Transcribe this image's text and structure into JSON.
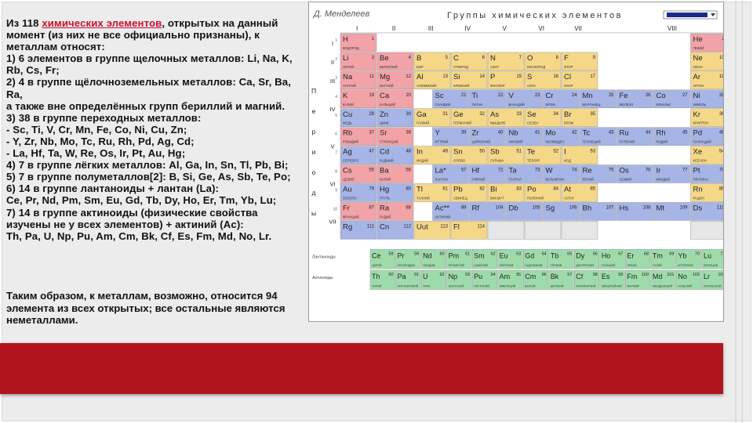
{
  "text": {
    "lines": [
      {
        "pre": "Из 118 ",
        "link": "химических элементов",
        "post": ", открытых на данный"
      },
      {
        "pre": "момент (из них не все официально признаны), к",
        "link": "",
        "post": ""
      },
      {
        "pre": "металлам относят:",
        "link": "",
        "post": ""
      },
      {
        "pre": "1) 6 элементов в группе щелочных металлов: Li, Na, K,",
        "link": "",
        "post": ""
      },
      {
        "pre": "Rb, Cs, Fr;",
        "link": "",
        "post": ""
      },
      {
        "pre": "2) 4 в группе щёлочноземельных металлов: Ca, Sr, Ba,",
        "link": "",
        "post": ""
      },
      {
        "pre": "Ra,",
        "link": "",
        "post": ""
      },
      {
        "pre": "а также вне определённых групп бериллий и магний.",
        "link": "",
        "post": ""
      },
      {
        "pre": "3) 38 в группе переходных металлов:",
        "link": "",
        "post": ""
      },
      {
        "pre": "- Sc, Ti, V, Cr, Mn, Fe, Co, Ni, Cu, Zn;",
        "link": "",
        "post": ""
      },
      {
        "pre": "- Y, Zr, Nb, Mo, Tc, Ru, Rh, Pd, Ag, Cd;",
        "link": "",
        "post": ""
      },
      {
        "pre": "- La, Hf, Ta, W, Re, Os, Ir, Pt, Au, Hg;",
        "link": "",
        "post": ""
      },
      {
        "pre": "4) 7 в группе лёгких металлов: Al, Ga, In, Sn, Tl, Pb, Bi;",
        "link": "",
        "post": ""
      },
      {
        "pre": "5) 7 в группе полуметаллов[2]: B, Si, Ge, As, Sb, Te, Po;",
        "link": "",
        "post": ""
      },
      {
        "pre": "6) 14 в группе лантаноиды + лантан (La):",
        "link": "",
        "post": ""
      },
      {
        "pre": "Ce, Pr, Nd, Pm, Sm, Eu, Gd, Tb, Dy, Ho, Er, Tm, Yb, Lu;",
        "link": "",
        "post": ""
      },
      {
        "pre": "7) 14 в группе актиноиды (физические свойства",
        "link": "",
        "post": ""
      },
      {
        "pre": "изучены не у всех элементов) + актиний (Ac):",
        "link": "",
        "post": ""
      },
      {
        "pre": "Th, Pa, U, Np, Pu, Am, Cm, Bk, Cf, Es, Fm, Md, No, Lr.",
        "link": "",
        "post": ""
      }
    ],
    "ending": [
      "Таким образом, к металлам, возможно, относится 94",
      "элемента из всех открытых; все остальные являются",
      "неметаллами."
    ]
  },
  "table": {
    "signature": "Д. Менделеев",
    "title": "Группы химических элементов",
    "groups": [
      "I",
      "II",
      "III",
      "IV",
      "V",
      "VI",
      "VII",
      "VIII"
    ],
    "period_word": [
      "П",
      "е",
      "р",
      "и",
      "о",
      "д",
      "ы"
    ],
    "periods": [
      "I",
      "II",
      "III",
      "IV",
      "V",
      "VI",
      "VII"
    ],
    "row_labels": [
      "1",
      "2",
      "3",
      "4",
      "5",
      "6",
      "7",
      "8",
      "9",
      "10"
    ],
    "lanthanide_label": "Лантаноиды",
    "actinide_label": "Актиноиды",
    "colors": {
      "s": "#f2a3a8",
      "p": "#f5d788",
      "d": "#a6b4e6",
      "f": "#9edbaa",
      "empty": "#e6e6e6"
    },
    "cells": [
      {
        "sym": "H",
        "n": "1",
        "name": "ВОДОРОД",
        "c": "s",
        "r": 0,
        "col": 0
      },
      {
        "sym": "He",
        "n": "2",
        "name": "ГЕЛИЙ",
        "c": "s",
        "r": 0,
        "col": 19
      },
      {
        "sym": "Li",
        "n": "3",
        "name": "ЛИТИЙ",
        "c": "s",
        "r": 1,
        "col": 0
      },
      {
        "sym": "Be",
        "n": "4",
        "name": "БЕРИЛЛИЙ",
        "c": "s",
        "r": 1,
        "col": 2
      },
      {
        "sym": "B",
        "n": "5",
        "name": "БОР",
        "c": "p",
        "r": 1,
        "col": 4
      },
      {
        "sym": "C",
        "n": "6",
        "name": "УГЛЕРОД",
        "c": "p",
        "r": 1,
        "col": 6
      },
      {
        "sym": "N",
        "n": "7",
        "name": "АЗОТ",
        "c": "p",
        "r": 1,
        "col": 8
      },
      {
        "sym": "O",
        "n": "8",
        "name": "КИСЛОРОД",
        "c": "p",
        "r": 1,
        "col": 10
      },
      {
        "sym": "F",
        "n": "9",
        "name": "ФТОР",
        "c": "p",
        "r": 1,
        "col": 12
      },
      {
        "sym": "Ne",
        "n": "10",
        "name": "НЕОН",
        "c": "p",
        "r": 1,
        "col": 19
      },
      {
        "sym": "Na",
        "n": "11",
        "name": "НАТРИЙ",
        "c": "s",
        "r": 2,
        "col": 0
      },
      {
        "sym": "Mg",
        "n": "12",
        "name": "МАГНИЙ",
        "c": "s",
        "r": 2,
        "col": 2
      },
      {
        "sym": "Al",
        "n": "13",
        "name": "АЛЮМИНИЙ",
        "c": "p",
        "r": 2,
        "col": 4
      },
      {
        "sym": "Si",
        "n": "14",
        "name": "КРЕМНИЙ",
        "c": "p",
        "r": 2,
        "col": 6
      },
      {
        "sym": "P",
        "n": "15",
        "name": "ФОСФОР",
        "c": "p",
        "r": 2,
        "col": 8
      },
      {
        "sym": "S",
        "n": "16",
        "name": "СЕРА",
        "c": "p",
        "r": 2,
        "col": 10
      },
      {
        "sym": "Cl",
        "n": "17",
        "name": "ХЛОР",
        "c": "p",
        "r": 2,
        "col": 12
      },
      {
        "sym": "Ar",
        "n": "18",
        "name": "АРГОН",
        "c": "p",
        "r": 2,
        "col": 19
      },
      {
        "sym": "K",
        "n": "19",
        "name": "КАЛИЙ",
        "c": "s",
        "r": 3,
        "col": 0
      },
      {
        "sym": "Ca",
        "n": "20",
        "name": "КАЛЬЦИЙ",
        "c": "s",
        "r": 3,
        "col": 2
      },
      {
        "sym": "Sc",
        "n": "21",
        "name": "СКАНДИЙ",
        "c": "d",
        "r": 3,
        "col": 5
      },
      {
        "sym": "Ti",
        "n": "22",
        "name": "ТИТАН",
        "c": "d",
        "r": 3,
        "col": 7
      },
      {
        "sym": "V",
        "n": "23",
        "name": "ВАНАДИЙ",
        "c": "d",
        "r": 3,
        "col": 9
      },
      {
        "sym": "Cr",
        "n": "24",
        "name": "ХРОМ",
        "c": "d",
        "r": 3,
        "col": 11
      },
      {
        "sym": "Mn",
        "n": "25",
        "name": "МАРГАНЕЦ",
        "c": "d",
        "r": 3,
        "col": 13
      },
      {
        "sym": "Fe",
        "n": "26",
        "name": "ЖЕЛЕЗО",
        "c": "d",
        "r": 3,
        "col": 15
      },
      {
        "sym": "Co",
        "n": "27",
        "name": "КОБАЛЬТ",
        "c": "d",
        "r": 3,
        "col": 17
      },
      {
        "sym": "Ni",
        "n": "28",
        "name": "НИКЕЛЬ",
        "c": "d",
        "r": 3,
        "col": 19
      },
      {
        "sym": "Cu",
        "n": "29",
        "name": "МЕДЬ",
        "c": "d",
        "r": 4,
        "col": 0
      },
      {
        "sym": "Zn",
        "n": "30",
        "name": "ЦИНК",
        "c": "d",
        "r": 4,
        "col": 2
      },
      {
        "sym": "Ga",
        "n": "31",
        "name": "ГАЛЛИЙ",
        "c": "p",
        "r": 4,
        "col": 4
      },
      {
        "sym": "Ge",
        "n": "32",
        "name": "ГЕРМАНИЙ",
        "c": "p",
        "r": 4,
        "col": 6
      },
      {
        "sym": "As",
        "n": "33",
        "name": "МЫШЬЯК",
        "c": "p",
        "r": 4,
        "col": 8
      },
      {
        "sym": "Se",
        "n": "34",
        "name": "СЕЛЕН",
        "c": "p",
        "r": 4,
        "col": 10
      },
      {
        "sym": "Br",
        "n": "35",
        "name": "БРОМ",
        "c": "p",
        "r": 4,
        "col": 12
      },
      {
        "sym": "Kr",
        "n": "36",
        "name": "КРИПТОН",
        "c": "p",
        "r": 4,
        "col": 19
      },
      {
        "sym": "Rb",
        "n": "37",
        "name": "РУБИДИЙ",
        "c": "s",
        "r": 5,
        "col": 0
      },
      {
        "sym": "Sr",
        "n": "38",
        "name": "СТРОНЦИЙ",
        "c": "s",
        "r": 5,
        "col": 2
      },
      {
        "sym": "Y",
        "n": "39",
        "name": "ИТТРИЙ",
        "c": "d",
        "r": 5,
        "col": 5
      },
      {
        "sym": "Zr",
        "n": "40",
        "name": "ЦИРКОНИЙ",
        "c": "d",
        "r": 5,
        "col": 7
      },
      {
        "sym": "Nb",
        "n": "41",
        "name": "НИОБИЙ",
        "c": "d",
        "r": 5,
        "col": 9
      },
      {
        "sym": "Mo",
        "n": "42",
        "name": "МОЛИБДЕН",
        "c": "d",
        "r": 5,
        "col": 11
      },
      {
        "sym": "Tc",
        "n": "43",
        "name": "ТЕХНЕЦИЙ",
        "c": "d",
        "r": 5,
        "col": 13
      },
      {
        "sym": "Ru",
        "n": "44",
        "name": "РУТЕНИЙ",
        "c": "d",
        "r": 5,
        "col": 15
      },
      {
        "sym": "Rh",
        "n": "45",
        "name": "РОДИЙ",
        "c": "d",
        "r": 5,
        "col": 17
      },
      {
        "sym": "Pd",
        "n": "46",
        "name": "ПАЛЛАДИЙ",
        "c": "d",
        "r": 5,
        "col": 19
      },
      {
        "sym": "Ag",
        "n": "47",
        "name": "СЕРЕБРО",
        "c": "d",
        "r": 6,
        "col": 0
      },
      {
        "sym": "Cd",
        "n": "48",
        "name": "КАДМИЙ",
        "c": "d",
        "r": 6,
        "col": 2
      },
      {
        "sym": "In",
        "n": "49",
        "name": "ИНДИЙ",
        "c": "p",
        "r": 6,
        "col": 4
      },
      {
        "sym": "Sn",
        "n": "50",
        "name": "ОЛОВО",
        "c": "p",
        "r": 6,
        "col": 6
      },
      {
        "sym": "Sb",
        "n": "51",
        "name": "СУРЬМА",
        "c": "p",
        "r": 6,
        "col": 8
      },
      {
        "sym": "Te",
        "n": "52",
        "name": "ТЕЛЛУР",
        "c": "p",
        "r": 6,
        "col": 10
      },
      {
        "sym": "I",
        "n": "53",
        "name": "ИОД",
        "c": "p",
        "r": 6,
        "col": 12
      },
      {
        "sym": "Xe",
        "n": "54",
        "name": "КСЕНОН",
        "c": "p",
        "r": 6,
        "col": 19
      },
      {
        "sym": "Cs",
        "n": "55",
        "name": "ЦЕЗИЙ",
        "c": "s",
        "r": 7,
        "col": 0
      },
      {
        "sym": "Ba",
        "n": "56",
        "name": "БАРИЙ",
        "c": "s",
        "r": 7,
        "col": 2
      },
      {
        "sym": "La*",
        "n": "57",
        "name": "ЛАНТАН",
        "c": "d",
        "r": 7,
        "col": 5
      },
      {
        "sym": "Hf",
        "n": "72",
        "name": "ГАФНИЙ",
        "c": "d",
        "r": 7,
        "col": 7
      },
      {
        "sym": "Ta",
        "n": "73",
        "name": "ТАНТАЛ",
        "c": "d",
        "r": 7,
        "col": 9
      },
      {
        "sym": "W",
        "n": "74",
        "name": "ВОЛЬФРАМ",
        "c": "d",
        "r": 7,
        "col": 11
      },
      {
        "sym": "Re",
        "n": "75",
        "name": "РЕНИЙ",
        "c": "d",
        "r": 7,
        "col": 13
      },
      {
        "sym": "Os",
        "n": "76",
        "name": "ОСМИЙ",
        "c": "d",
        "r": 7,
        "col": 15
      },
      {
        "sym": "Ir",
        "n": "77",
        "name": "ИРИДИЙ",
        "c": "d",
        "r": 7,
        "col": 17
      },
      {
        "sym": "Pt",
        "n": "78",
        "name": "ПЛАТИНА",
        "c": "d",
        "r": 7,
        "col": 19
      },
      {
        "sym": "Au",
        "n": "79",
        "name": "ЗОЛОТО",
        "c": "d",
        "r": 8,
        "col": 0
      },
      {
        "sym": "Hg",
        "n": "80",
        "name": "РТУТЬ",
        "c": "d",
        "r": 8,
        "col": 2
      },
      {
        "sym": "Tl",
        "n": "81",
        "name": "ТАЛЛИЙ",
        "c": "p",
        "r": 8,
        "col": 4
      },
      {
        "sym": "Pb",
        "n": "82",
        "name": "СВИНЕЦ",
        "c": "p",
        "r": 8,
        "col": 6
      },
      {
        "sym": "Bi",
        "n": "83",
        "name": "ВИСМУТ",
        "c": "p",
        "r": 8,
        "col": 8
      },
      {
        "sym": "Po",
        "n": "84",
        "name": "ПОЛОНИЙ",
        "c": "p",
        "r": 8,
        "col": 10
      },
      {
        "sym": "At",
        "n": "85",
        "name": "АСТАТ",
        "c": "p",
        "r": 8,
        "col": 12
      },
      {
        "sym": "Rn",
        "n": "86",
        "name": "РАДОН",
        "c": "p",
        "r": 8,
        "col": 19
      },
      {
        "sym": "Fr",
        "n": "87",
        "name": "ФРАНЦИЙ",
        "c": "s",
        "r": 9,
        "col": 0
      },
      {
        "sym": "Ra",
        "n": "88",
        "name": "РАДИЙ",
        "c": "s",
        "r": 9,
        "col": 2
      },
      {
        "sym": "Ac**",
        "n": "89",
        "name": "АКТИНИЙ",
        "c": "d",
        "r": 9,
        "col": 5
      },
      {
        "sym": "Rf",
        "n": "104",
        "name": "",
        "c": "d",
        "r": 9,
        "col": 7
      },
      {
        "sym": "Db",
        "n": "105",
        "name": "",
        "c": "d",
        "r": 9,
        "col": 9
      },
      {
        "sym": "Sg",
        "n": "106",
        "name": "",
        "c": "d",
        "r": 9,
        "col": 11
      },
      {
        "sym": "Bh",
        "n": "107",
        "name": "",
        "c": "d",
        "r": 9,
        "col": 13
      },
      {
        "sym": "Hs",
        "n": "108",
        "name": "",
        "c": "d",
        "r": 9,
        "col": 15
      },
      {
        "sym": "Mt",
        "n": "109",
        "name": "",
        "c": "d",
        "r": 9,
        "col": 17
      },
      {
        "sym": "Ds",
        "n": "110",
        "name": "",
        "c": "d",
        "r": 9,
        "col": 19
      },
      {
        "sym": "Rg",
        "n": "111",
        "name": "",
        "c": "d",
        "r": 10,
        "col": 0
      },
      {
        "sym": "Cn",
        "n": "112",
        "name": "",
        "c": "d",
        "r": 10,
        "col": 2
      },
      {
        "sym": "Uut",
        "n": "113",
        "name": "",
        "c": "p",
        "r": 10,
        "col": 4
      },
      {
        "sym": "Fl",
        "n": "114",
        "name": "",
        "c": "p",
        "r": 10,
        "col": 6
      },
      {
        "sym": "",
        "n": "",
        "name": "",
        "c": "empty",
        "r": 10,
        "col": 8
      },
      {
        "sym": "",
        "n": "",
        "name": "",
        "c": "empty",
        "r": 10,
        "col": 10
      },
      {
        "sym": "",
        "n": "",
        "name": "",
        "c": "empty",
        "r": 10,
        "col": 12
      },
      {
        "sym": "",
        "n": "",
        "name": "",
        "c": "empty",
        "r": 10,
        "col": 19
      }
    ],
    "lanthanides": [
      {
        "sym": "Ce",
        "n": "58",
        "name": "ЦЕРИЙ"
      },
      {
        "sym": "Pr",
        "n": "59",
        "name": "ПРАЗЕОДИМ"
      },
      {
        "sym": "Nd",
        "n": "60",
        "name": "НЕОДИМ"
      },
      {
        "sym": "Pm",
        "n": "61",
        "name": "ПРОМЕТИЙ"
      },
      {
        "sym": "Sm",
        "n": "62",
        "name": "САМАРИЙ"
      },
      {
        "sym": "Eu",
        "n": "63",
        "name": "ЕВРОПИЙ"
      },
      {
        "sym": "Gd",
        "n": "64",
        "name": "ГАДОЛИНИЙ"
      },
      {
        "sym": "Tb",
        "n": "65",
        "name": "ТЕРБИЙ"
      },
      {
        "sym": "Dy",
        "n": "66",
        "name": "ДИСПРОЗИЙ"
      },
      {
        "sym": "Ho",
        "n": "67",
        "name": "ГОЛЬМИЙ"
      },
      {
        "sym": "Er",
        "n": "68",
        "name": "ЭРБИЙ"
      },
      {
        "sym": "Tm",
        "n": "69",
        "name": "ТУЛИЙ"
      },
      {
        "sym": "Yb",
        "n": "70",
        "name": "ИТТЕРБИЙ"
      },
      {
        "sym": "Lu",
        "n": "71",
        "name": "ЛЮТЕЦИЙ"
      }
    ],
    "actinides": [
      {
        "sym": "Th",
        "n": "90",
        "name": "ТОРИЙ"
      },
      {
        "sym": "Pa",
        "n": "91",
        "name": "ПРОТАКТИНИЙ"
      },
      {
        "sym": "U",
        "n": "92",
        "name": "УРАН"
      },
      {
        "sym": "Np",
        "n": "93",
        "name": "НЕПТУНИЙ"
      },
      {
        "sym": "Pu",
        "n": "94",
        "name": "ПЛУТОНИЙ"
      },
      {
        "sym": "Am",
        "n": "95",
        "name": "АМЕРИЦИЙ"
      },
      {
        "sym": "Cm",
        "n": "96",
        "name": "КЮРИЙ"
      },
      {
        "sym": "Bk",
        "n": "97",
        "name": "БЕРКЛИЙ"
      },
      {
        "sym": "Cf",
        "n": "98",
        "name": "КАЛИФОРНИЙ"
      },
      {
        "sym": "Es",
        "n": "99",
        "name": "ЭЙНШТЕЙНИЙ"
      },
      {
        "sym": "Fm",
        "n": "100",
        "name": "ФЕРМИЙ"
      },
      {
        "sym": "Md",
        "n": "101",
        "name": "МЕНДЕЛЕВИЙ"
      },
      {
        "sym": "No",
        "n": "102",
        "name": "НОБЕЛИЙ"
      },
      {
        "sym": "Lr",
        "n": "103",
        "name": "ЛОУРЕНСИЙ"
      }
    ]
  }
}
